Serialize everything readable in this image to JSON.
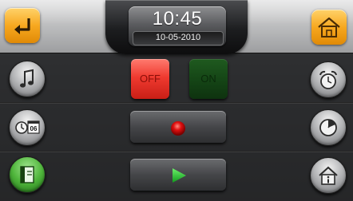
{
  "clock": {
    "time": "10:45",
    "date": "10-05-2010"
  },
  "header": {
    "back_icon": "back-arrow-icon",
    "home_icon": "home-icon"
  },
  "power": {
    "off_label": "OFF",
    "on_label": "ON",
    "state": "off"
  },
  "controls": {
    "record_icon": "record-icon",
    "play_icon": "play-icon"
  },
  "left_menu": [
    {
      "icon": "music-note-icon"
    },
    {
      "icon": "clock-calendar-icon",
      "badge": "06"
    },
    {
      "icon": "phone-book-icon"
    }
  ],
  "right_menu": [
    {
      "icon": "alarm-clock-icon"
    },
    {
      "icon": "gauge-icon"
    },
    {
      "icon": "info-house-icon"
    }
  ],
  "colors": {
    "accent_orange": "#f7a820",
    "off_red": "#ef3a30",
    "on_green": "#154616",
    "record_red": "#e01010",
    "play_green": "#1fbf2a",
    "active_green": "#4fb53b"
  }
}
